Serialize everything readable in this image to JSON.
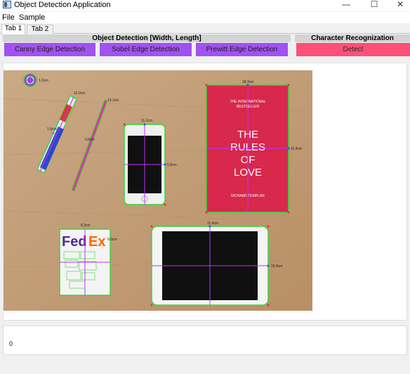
{
  "window": {
    "title": "Object Detection Application",
    "controls": [
      "—",
      "☐",
      "✕"
    ]
  },
  "menu": [
    "File",
    "Sample"
  ],
  "tabs": [
    {
      "label": "Tab 1",
      "active": true
    },
    {
      "label": "Tab 2",
      "active": false
    }
  ],
  "sections": {
    "object_detection": "Object Detection [Width, Length]",
    "character_recognition": "Character Recognization"
  },
  "buttons": {
    "canny": "Canny Edge Detection",
    "sobel": "Sobel Edge Detection",
    "prewitt": "Prewitt Edge Detection",
    "detect": "Detect"
  },
  "colors": {
    "purple_button": "#a152f1",
    "pink_button": "#fb5179",
    "background": "#f0f0f0",
    "edge_green": "#3fd23f",
    "axis_magenta": "#c030ff"
  },
  "image_labels": {
    "coin": "1.0cm",
    "marker": "12.0cm",
    "marker_side": "1.8cm",
    "pencil": "13.1cm",
    "pencil_side": "0.8cm",
    "phone_top": "11.2cm",
    "phone_side": "5.8cm",
    "book_top": "18.3cm",
    "book_side": "11.4cm",
    "tablet_top": "11.4cm",
    "tablet_side": "16.8cm",
    "card_top": "8.3cm",
    "card_side": "6.0cm"
  },
  "book": {
    "line1": "THE INTERNATIONAL",
    "line2": "BESTSELLER",
    "title1": "THE",
    "title2": "RULES",
    "title3": "OF",
    "title4": "LOVE",
    "author": "RICHARD TEMPLAR"
  },
  "card_logo": {
    "part1": "Fed",
    "part2": "Ex"
  },
  "output": {
    "value": "0"
  }
}
